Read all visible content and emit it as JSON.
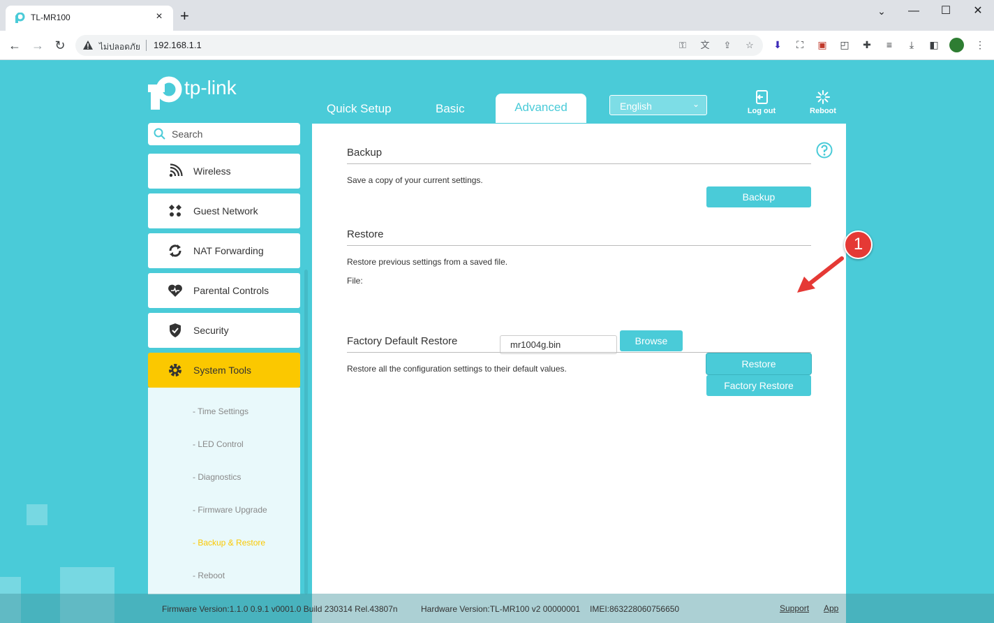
{
  "browser": {
    "tab_title": "TL-MR100",
    "tab_close": "×",
    "new_tab": "+",
    "window_controls": {
      "minimize": "—",
      "maximize": "☐",
      "close": "✕"
    },
    "nav": {
      "back": "←",
      "forward": "→",
      "reload": "↻"
    },
    "address": {
      "security_label": "ไม่ปลอดภัย",
      "url": "192.168.1.1"
    }
  },
  "router": {
    "brand": "tp-link",
    "nav_tabs": [
      {
        "label": "Quick Setup"
      },
      {
        "label": "Basic"
      },
      {
        "label": "Advanced"
      }
    ],
    "language": "English",
    "logout_label": "Log out",
    "reboot_label": "Reboot",
    "search_placeholder": "Search",
    "menu": [
      {
        "label": "Wireless"
      },
      {
        "label": "Guest Network"
      },
      {
        "label": "NAT Forwarding"
      },
      {
        "label": "Parental Controls"
      },
      {
        "label": "Security"
      },
      {
        "label": "System Tools"
      }
    ],
    "submenu": [
      {
        "label": "- Time Settings"
      },
      {
        "label": "- LED Control"
      },
      {
        "label": "- Diagnostics"
      },
      {
        "label": "- Firmware Upgrade"
      },
      {
        "label": "- Backup & Restore"
      },
      {
        "label": "- Reboot"
      }
    ],
    "backup": {
      "title": "Backup",
      "desc": "Save a copy of your current settings.",
      "button": "Backup"
    },
    "restore": {
      "title": "Restore",
      "desc": "Restore previous settings from a saved file.",
      "file_label": "File:",
      "file_value": "mr1004g.bin",
      "browse_button": "Browse",
      "button": "Restore"
    },
    "factory": {
      "title": "Factory Default Restore",
      "desc": "Restore all the configuration settings to their default values.",
      "button": "Factory Restore"
    },
    "footer": {
      "firmware": "Firmware Version:1.1.0 0.9.1 v0001.0 Build 230314 Rel.43807n",
      "hardware": "Hardware Version:TL-MR100 v2 00000001",
      "imei": "IMEI:863228060756650",
      "support": "Support",
      "app": "App"
    }
  },
  "annotation": {
    "step_number": "1"
  },
  "colors": {
    "accent": "#4acbd8",
    "active_menu": "#fbc800",
    "badge": "#e53935"
  }
}
